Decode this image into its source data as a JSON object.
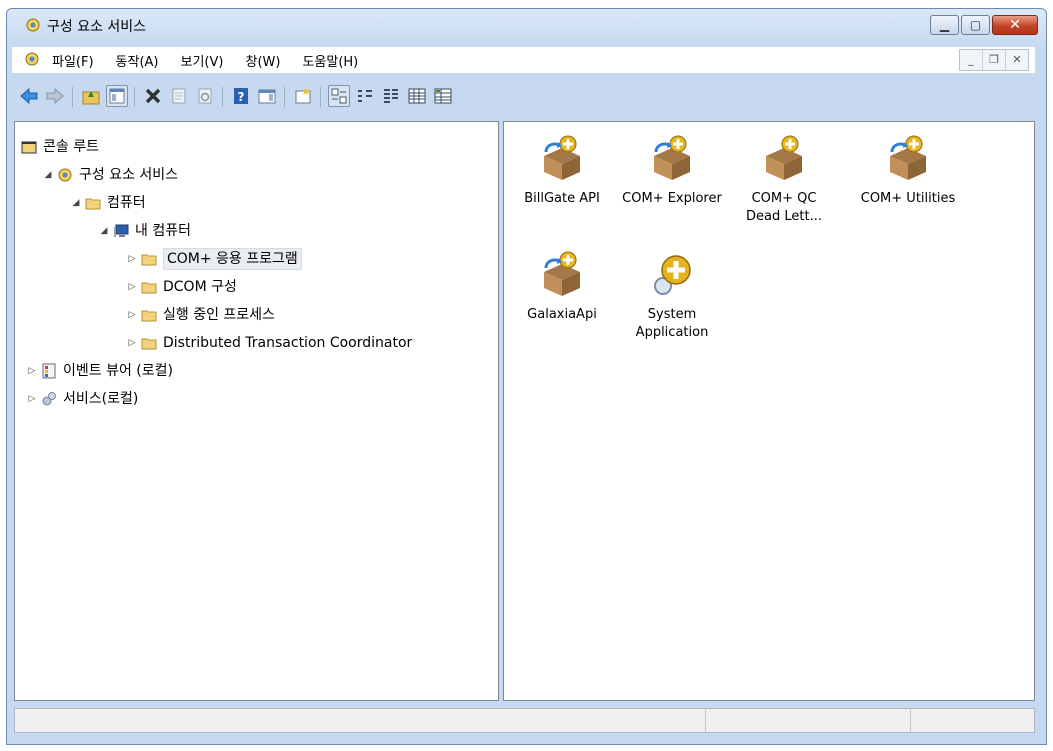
{
  "window": {
    "title": "구성 요소 서비스"
  },
  "menu": {
    "items": [
      "파일(F)",
      "동작(A)",
      "보기(V)",
      "창(W)",
      "도움말(H)"
    ]
  },
  "toolbar": {
    "buttons": [
      "back-icon",
      "forward-icon",
      "up-folder-icon",
      "show-hide-tree-icon",
      "delete-icon",
      "properties-icon",
      "refresh-icon",
      "help-icon",
      "show-action-pane-icon",
      "new-window-icon",
      "large-icons-view-icon",
      "small-icons-view-icon",
      "list-view-icon",
      "detail-view-icon",
      "status-view-icon"
    ]
  },
  "tree": [
    {
      "label": "콘솔 루트",
      "level": 0,
      "expander": "",
      "icon": "console-root-icon"
    },
    {
      "label": "구성 요소 서비스",
      "level": 1,
      "expander": "◢",
      "icon": "component-services-icon"
    },
    {
      "label": "컴퓨터",
      "level": 2,
      "expander": "◢",
      "icon": "folder-icon"
    },
    {
      "label": "내 컴퓨터",
      "level": 3,
      "expander": "◢",
      "icon": "my-computer-icon"
    },
    {
      "label": "COM+ 응용 프로그램",
      "level": 4,
      "expander": "▷",
      "icon": "folder-icon",
      "selected": true
    },
    {
      "label": "DCOM 구성",
      "level": 4,
      "expander": "▷",
      "icon": "folder-icon"
    },
    {
      "label": "실행 중인 프로세스",
      "level": 4,
      "expander": "▷",
      "icon": "folder-icon"
    },
    {
      "label": "Distributed Transaction Coordinator",
      "level": 4,
      "expander": "▷",
      "icon": "folder-icon"
    },
    {
      "label": "이벤트 뷰어 (로컬)",
      "level": 0,
      "expander": "▷",
      "icon": "event-viewer-icon"
    },
    {
      "label": "서비스(로컬)",
      "level": 0,
      "expander": "▷",
      "icon": "services-gear-icon"
    }
  ],
  "apps": [
    {
      "label": "BillGate API",
      "icon": "com-app-box-icon"
    },
    {
      "label": "COM+ Explorer",
      "icon": "com-app-box-icon"
    },
    {
      "label": "COM+ QC Dead Lett...",
      "icon": "com-app-box-plain-icon"
    },
    {
      "label": "COM+ Utilities",
      "icon": "com-app-box-icon"
    },
    {
      "label": "GalaxiaApi",
      "icon": "com-app-box-icon"
    },
    {
      "label": "System Application",
      "icon": "system-app-gear-icon"
    }
  ],
  "colors": {
    "titlebar": "#c6d9f0",
    "close": "#c2452a",
    "selection": "#e9edf2"
  }
}
